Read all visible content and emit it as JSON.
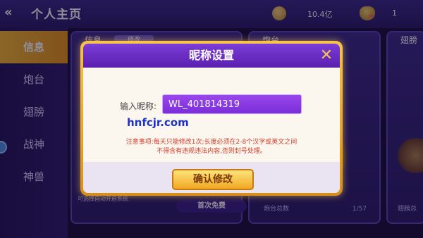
{
  "header": {
    "back_icon": "double-chevron-left-icon",
    "title": "个人主页",
    "coins": {
      "icon": "coin-bag-icon",
      "value": "10.4亿"
    },
    "gems": {
      "icon": "gold-bag-plus-icon",
      "value": "1"
    }
  },
  "sidebar": {
    "items": [
      {
        "label": "信息",
        "active": true
      },
      {
        "label": "炮台"
      },
      {
        "label": "翅膀"
      },
      {
        "label": "战神"
      },
      {
        "label": "神兽"
      }
    ]
  },
  "panels": {
    "info": {
      "title": "信息",
      "edit_label": "修改",
      "footer": "可选择自动开启系统"
    },
    "cannon": {
      "title": "炮台",
      "total_label": "炮台总数",
      "total_value": "1/57"
    },
    "wing": {
      "title": "翅膀",
      "total_label": "翅膀总"
    },
    "first_free": "首次免费"
  },
  "modal": {
    "title": "昵称设置",
    "close_icon": "close-x-icon",
    "name_label": "输入昵称:",
    "name_value": "WL_401814319",
    "watermark": "hnfcjr.com",
    "notice_line1": "注意事项:每天只能修改1次;长度必须在2-8个汉字或英文之间",
    "notice_line2": "不得含有违规违法内容,否则封号处理。",
    "confirm_label": "确认修改"
  },
  "colors": {
    "modal_header": "#6a2cc4",
    "modal_border": "#f0b531",
    "confirm_button": "#f6c54a",
    "notice_text": "#d23c2a",
    "input_bg": "#8a3ae4"
  }
}
